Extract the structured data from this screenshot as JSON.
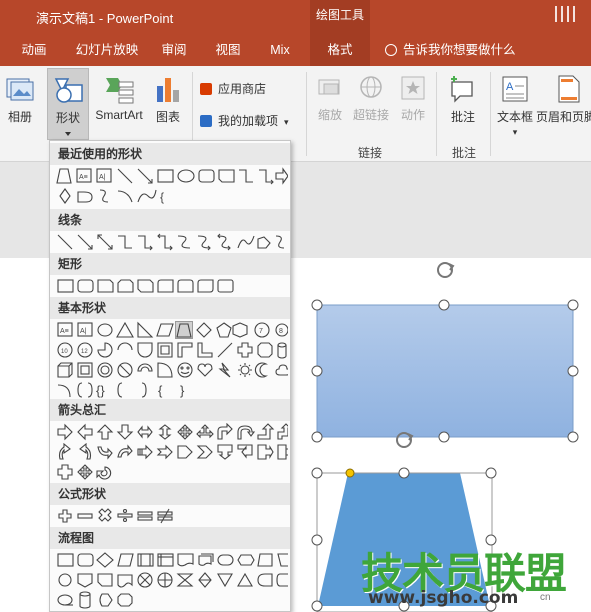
{
  "window": {
    "title": "演示文稿1 - PowerPoint",
    "context_tool": "绘图工具"
  },
  "tabs": [
    {
      "label": "动画"
    },
    {
      "label": "幻灯片放映"
    },
    {
      "label": "审阅"
    },
    {
      "label": "视图"
    },
    {
      "label": "Mix"
    },
    {
      "label": "格式",
      "active": true
    }
  ],
  "tell_me": "告诉我你想要做什么",
  "ribbon": {
    "album": "相册",
    "shapes": "形状",
    "smartart": "SmartArt",
    "chart": "图表",
    "app_store": "应用商店",
    "my_addins": "我的加载项",
    "zoom": "缩放",
    "hyperlink": "超链接",
    "action": "动作",
    "comment": "批注",
    "textbox": "文本框",
    "header_footer": "页眉和页脚",
    "group_links": "链接",
    "group_comments": "批注"
  },
  "shapes_menu": {
    "sections": [
      {
        "title": "最近使用的形状"
      },
      {
        "title": "线条"
      },
      {
        "title": "矩形"
      },
      {
        "title": "基本形状"
      },
      {
        "title": "箭头总汇"
      },
      {
        "title": "公式形状"
      },
      {
        "title": "流程图"
      }
    ]
  },
  "watermark": {
    "brand": "技术员联盟",
    "url": "www.jsgho.com",
    "small": "cn"
  },
  "colors": {
    "accent": "#b7472a",
    "accent_dark": "#a33d23",
    "shape_fill_light": "#a9c4e8",
    "shape_fill": "#5b9bd5",
    "watermark_green": "#3fa63a"
  }
}
